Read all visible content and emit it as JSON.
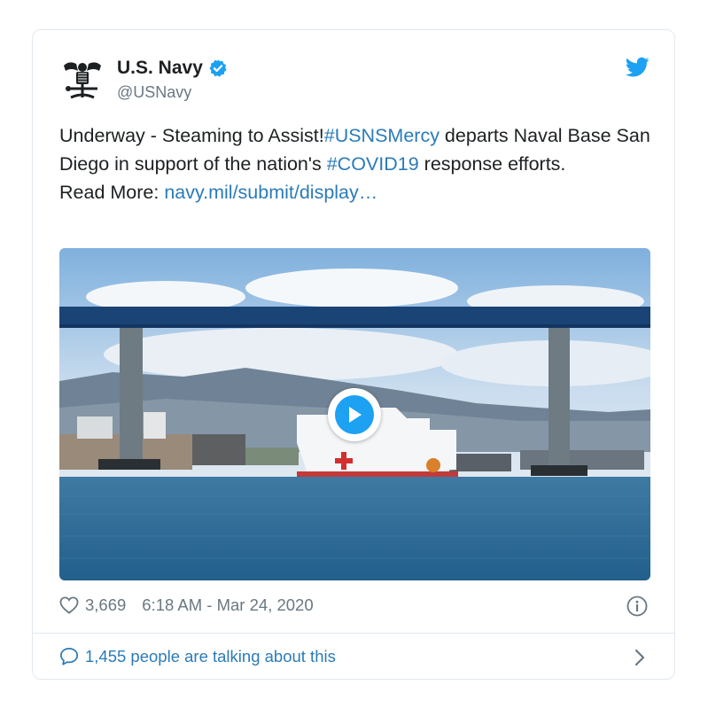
{
  "tweet": {
    "author_name": "U.S. Navy",
    "author_handle": "@USNavy",
    "text_parts": [
      "Underway - Steaming to Assist!",
      "#USNSMercy",
      " departs Naval Base San Diego in support of the nation's ",
      "#COVID19",
      " response efforts.",
      "Read More: ",
      "navy.mil/submit/display…"
    ],
    "likes": "3,669",
    "timestamp": "6:18 AM - Mar 24, 2020",
    "talking": "1,455 people are talking about this"
  },
  "icons": {
    "avatar": "navy-eagle-logo",
    "verified": "verified-badge-icon",
    "bird": "twitter-bird-icon",
    "play": "play-icon",
    "like": "heart-icon",
    "info": "info-icon",
    "reply": "speech-bubble-icon",
    "more": "chevron-right-icon"
  },
  "colors": {
    "link": "#2b7bb9",
    "brand": "#1da1f2",
    "muted": "#697882",
    "border": "#e1e8ed"
  }
}
